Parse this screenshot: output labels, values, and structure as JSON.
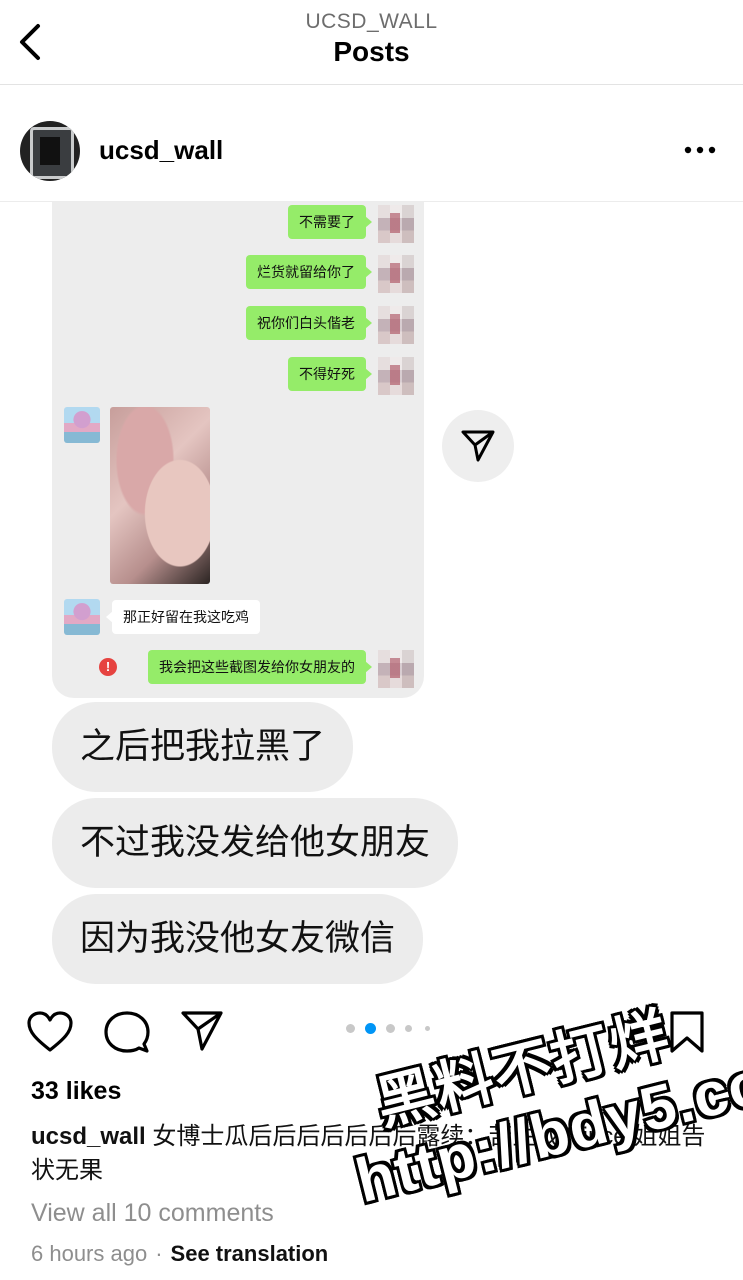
{
  "header": {
    "account": "UCSD_WALL",
    "title": "Posts"
  },
  "post": {
    "username": "ucsd_wall",
    "chat_screenshot": {
      "sent_messages": [
        "不需要了",
        "烂货就留给你了",
        "祝你们白头偕老",
        "不得好死"
      ],
      "received_message": "那正好留在我这吃鸡",
      "failed_message": "我会把这些截图发给你女朋友的",
      "failed_icon": "!"
    },
    "text_bubbles": [
      "之后把我拉黑了",
      "不过我没发给他女朋友",
      "因为我没他女友微信"
    ],
    "likes": "33 likes",
    "caption_user": "ucsd_wall",
    "caption_text": "女博士瓜后后后后后后后露续：苦主找 Vince 姐姐告状无果",
    "view_comments": "View all 10 comments",
    "time": "6 hours ago",
    "separator": "·",
    "see_translation": "See translation",
    "carousel": {
      "count": 5,
      "active_index": 1
    }
  },
  "watermark": {
    "line1": "黑料不打烊",
    "line2": "http://bdy5.co"
  },
  "icons": {
    "back": "chevron-left-icon",
    "more": "more-horizontal-icon",
    "like": "heart-icon",
    "comment": "comment-icon",
    "share": "send-icon",
    "save": "bookmark-icon"
  },
  "colors": {
    "wechat_green": "#95ec69",
    "chat_bg": "#ededed",
    "active_dot": "#0095f6",
    "error_red": "#e64340"
  }
}
